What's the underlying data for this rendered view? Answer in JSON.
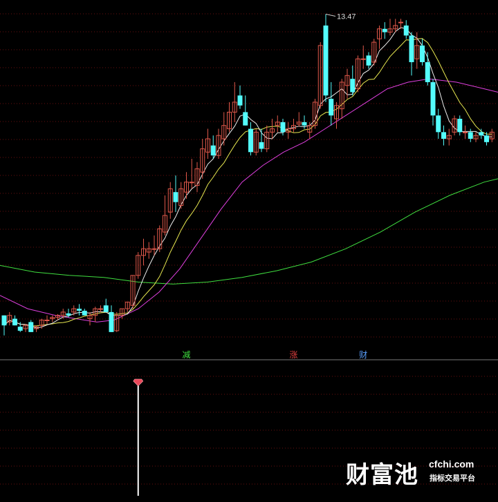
{
  "chart_data": [
    {
      "type": "candlestick",
      "title": "",
      "ylim": [
        8.45,
        13.6
      ],
      "up_color": "#e0584a",
      "down_color": "#54fcfc",
      "grid": true,
      "peak_label": "13.47",
      "ohlc": [
        [
          8.95,
          8.95,
          8.65,
          8.8
        ],
        [
          8.85,
          9.0,
          8.8,
          8.95
        ],
        [
          8.9,
          8.95,
          8.8,
          8.8
        ],
        [
          8.78,
          8.85,
          8.7,
          8.72
        ],
        [
          8.75,
          8.82,
          8.7,
          8.8
        ],
        [
          8.85,
          8.88,
          8.7,
          8.7
        ],
        [
          8.75,
          8.8,
          8.7,
          8.78
        ],
        [
          8.8,
          8.9,
          8.75,
          8.88
        ],
        [
          8.88,
          8.95,
          8.82,
          8.88
        ],
        [
          8.9,
          8.95,
          8.85,
          8.92
        ],
        [
          8.92,
          8.97,
          8.88,
          8.95
        ],
        [
          8.95,
          9.05,
          8.9,
          9.0
        ],
        [
          8.98,
          9.05,
          8.92,
          8.95
        ],
        [
          9.0,
          9.1,
          8.95,
          9.05
        ],
        [
          9.05,
          9.12,
          8.95,
          9.02
        ],
        [
          9.02,
          9.05,
          8.95,
          8.95
        ],
        [
          8.9,
          9.0,
          8.8,
          8.95
        ],
        [
          8.95,
          9.08,
          8.85,
          9.05
        ],
        [
          9.05,
          9.1,
          9.0,
          9.05
        ],
        [
          9.1,
          9.2,
          9.0,
          9.0
        ],
        [
          9.0,
          9.1,
          8.7,
          8.7
        ],
        [
          8.72,
          9.0,
          8.7,
          8.95
        ],
        [
          8.95,
          9.05,
          8.9,
          9.05
        ],
        [
          9.05,
          9.15,
          9.0,
          9.15
        ],
        [
          9.1,
          9.55,
          9.05,
          9.55
        ],
        [
          9.55,
          9.9,
          9.5,
          9.85
        ],
        [
          9.85,
          10.1,
          9.7,
          9.95
        ],
        [
          9.9,
          10.05,
          9.8,
          9.95
        ],
        [
          9.95,
          10.15,
          9.85,
          9.95
        ],
        [
          9.95,
          10.3,
          9.9,
          10.25
        ],
        [
          10.2,
          10.75,
          10.15,
          10.45
        ],
        [
          10.5,
          10.95,
          10.4,
          10.85
        ],
        [
          10.8,
          11.05,
          10.5,
          10.65
        ],
        [
          10.6,
          10.95,
          10.55,
          10.85
        ],
        [
          10.8,
          11.1,
          10.7,
          10.95
        ],
        [
          10.95,
          11.3,
          10.85,
          10.95
        ],
        [
          10.9,
          11.25,
          10.8,
          11.15
        ],
        [
          11.1,
          11.6,
          11.0,
          11.45
        ],
        [
          11.4,
          11.75,
          11.3,
          11.6
        ],
        [
          11.5,
          11.65,
          11.3,
          11.35
        ],
        [
          11.35,
          11.75,
          11.3,
          11.65
        ],
        [
          11.6,
          12.0,
          11.5,
          11.8
        ],
        [
          11.75,
          12.15,
          11.7,
          12.0
        ],
        [
          12.0,
          12.45,
          11.85,
          12.15
        ],
        [
          12.25,
          12.4,
          12.05,
          12.1
        ],
        [
          12.0,
          12.25,
          11.8,
          11.8
        ],
        [
          11.75,
          11.85,
          11.35,
          11.4
        ],
        [
          11.4,
          11.75,
          11.35,
          11.7
        ],
        [
          11.55,
          11.75,
          11.4,
          11.45
        ],
        [
          11.45,
          11.8,
          11.4,
          11.7
        ],
        [
          11.7,
          11.9,
          11.6,
          11.75
        ],
        [
          11.8,
          11.95,
          11.7,
          11.85
        ],
        [
          11.85,
          11.9,
          11.65,
          11.7
        ],
        [
          11.7,
          11.85,
          11.6,
          11.75
        ],
        [
          11.75,
          11.9,
          11.7,
          11.8
        ],
        [
          11.82,
          12.0,
          11.78,
          11.85
        ],
        [
          11.85,
          11.95,
          11.75,
          11.8
        ],
        [
          11.7,
          11.85,
          11.6,
          11.8
        ],
        [
          11.8,
          12.2,
          11.75,
          12.15
        ],
        [
          12.1,
          13.05,
          12.05,
          13.0
        ],
        [
          13.3,
          13.47,
          12.15,
          12.25
        ],
        [
          12.2,
          12.45,
          11.8,
          11.95
        ],
        [
          11.9,
          12.15,
          11.75,
          12.1
        ],
        [
          12.05,
          12.5,
          11.9,
          12.45
        ],
        [
          12.4,
          12.65,
          12.2,
          12.55
        ],
        [
          12.5,
          12.7,
          12.25,
          12.3
        ],
        [
          12.35,
          12.85,
          12.3,
          12.8
        ],
        [
          12.8,
          13.0,
          12.65,
          12.8
        ],
        [
          12.85,
          12.9,
          12.65,
          12.7
        ],
        [
          12.75,
          13.1,
          12.7,
          13.05
        ],
        [
          13.1,
          13.3,
          12.95,
          13.25
        ],
        [
          13.25,
          13.35,
          13.1,
          13.2
        ],
        [
          13.2,
          13.4,
          13.15,
          13.25
        ],
        [
          13.25,
          13.4,
          13.2,
          13.3
        ],
        [
          13.35,
          13.4,
          13.25,
          13.35
        ],
        [
          13.3,
          13.38,
          13.1,
          13.15
        ],
        [
          13.15,
          13.2,
          12.55,
          12.75
        ],
        [
          12.8,
          13.2,
          12.65,
          13.0
        ],
        [
          13.0,
          13.1,
          12.7,
          12.75
        ],
        [
          12.75,
          12.9,
          12.4,
          12.45
        ],
        [
          12.45,
          12.5,
          11.8,
          11.95
        ],
        [
          11.95,
          12.05,
          11.6,
          11.7
        ],
        [
          11.7,
          11.8,
          11.5,
          11.6
        ],
        [
          11.6,
          11.75,
          11.5,
          11.65
        ],
        [
          11.7,
          11.95,
          11.65,
          11.9
        ],
        [
          11.9,
          11.95,
          11.65,
          11.7
        ],
        [
          11.7,
          11.8,
          11.6,
          11.7
        ],
        [
          11.7,
          11.75,
          11.55,
          11.6
        ],
        [
          11.6,
          11.7,
          11.55,
          11.65
        ],
        [
          11.7,
          11.75,
          11.6,
          11.65
        ],
        [
          11.65,
          11.7,
          11.5,
          11.55
        ],
        [
          11.6,
          11.75,
          11.55,
          11.7
        ]
      ],
      "ma": [
        {
          "period": 5,
          "color": "#f0f0f0"
        },
        {
          "period": 10,
          "color": "#e8e850"
        },
        {
          "period": 30,
          "color": "#e040e0"
        },
        {
          "period": 60,
          "color": "#40e040"
        }
      ],
      "ma60_curve": [
        [
          0,
          9.7
        ],
        [
          50,
          9.6
        ],
        [
          100,
          9.55
        ],
        [
          150,
          9.52
        ],
        [
          200,
          9.45
        ],
        [
          250,
          9.42
        ],
        [
          300,
          9.45
        ],
        [
          350,
          9.52
        ],
        [
          400,
          9.62
        ],
        [
          450,
          9.75
        ],
        [
          500,
          9.95
        ],
        [
          550,
          10.2
        ],
        [
          600,
          10.5
        ],
        [
          650,
          10.75
        ],
        [
          700,
          10.95
        ],
        [
          720,
          11.0
        ]
      ],
      "ma30_curve": [
        [
          0,
          9.25
        ],
        [
          40,
          9.05
        ],
        [
          80,
          8.95
        ],
        [
          110,
          8.9
        ],
        [
          140,
          8.85
        ],
        [
          165,
          8.88
        ],
        [
          200,
          9.05
        ],
        [
          230,
          9.3
        ],
        [
          260,
          9.65
        ],
        [
          290,
          10.1
        ],
        [
          320,
          10.55
        ],
        [
          350,
          10.95
        ],
        [
          380,
          11.2
        ],
        [
          410,
          11.4
        ],
        [
          440,
          11.55
        ],
        [
          470,
          11.75
        ],
        [
          500,
          11.95
        ],
        [
          530,
          12.15
        ],
        [
          560,
          12.35
        ],
        [
          590,
          12.45
        ],
        [
          620,
          12.5
        ],
        [
          660,
          12.45
        ],
        [
          700,
          12.35
        ],
        [
          720,
          12.3
        ]
      ],
      "signal_labels": [
        {
          "text": "减",
          "color": "#40e040",
          "bar": 34
        },
        {
          "text": "涨",
          "color": "#e04040",
          "bar": 54
        },
        {
          "text": "财",
          "color": "#5aa0ff",
          "bar": 67
        }
      ]
    },
    {
      "type": "bar",
      "title": "",
      "ylim": [
        0,
        1
      ],
      "spike_bar": 25,
      "values_note": "single vertical spike",
      "spike_value": 1,
      "marker": "diamond-icon",
      "marker_color": "#e8485a",
      "spike_color": "#ffffff"
    }
  ],
  "watermark": {
    "brand": "财富池",
    "url": "cfchi.com",
    "tagline": "指标交易平台"
  }
}
